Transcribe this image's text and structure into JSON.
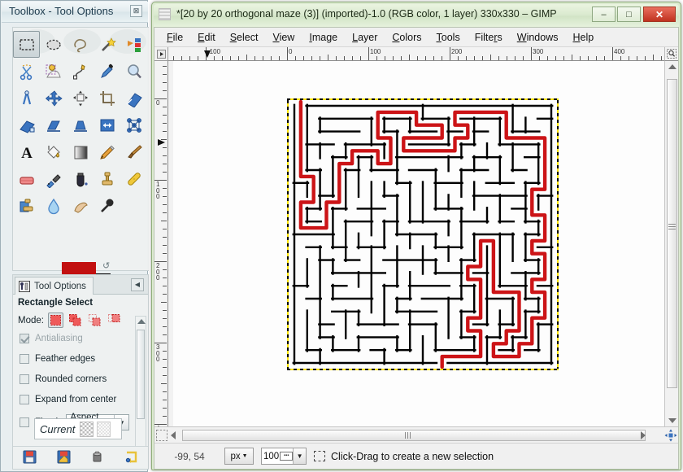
{
  "toolbox": {
    "title": "Toolbox - Tool Options",
    "close_label": "⊠",
    "tools": [
      {
        "name": "rectangle-select-tool",
        "icon": "rect-select",
        "active": true
      },
      {
        "name": "ellipse-select-tool",
        "icon": "ellipse-select",
        "active": false
      },
      {
        "name": "free-select-tool",
        "icon": "lasso",
        "active": false
      },
      {
        "name": "fuzzy-select-tool",
        "icon": "magic-wand",
        "active": false
      },
      {
        "name": "select-by-color-tool",
        "icon": "color-select",
        "active": false
      },
      {
        "name": "scissors-select-tool",
        "icon": "scissors",
        "active": false
      },
      {
        "name": "foreground-select-tool",
        "icon": "foreground-select",
        "active": false
      },
      {
        "name": "paths-tool",
        "icon": "path",
        "active": false
      },
      {
        "name": "color-picker-tool",
        "icon": "eyedropper",
        "active": false
      },
      {
        "name": "zoom-tool",
        "icon": "magnifier",
        "active": false
      },
      {
        "name": "measure-tool",
        "icon": "compass",
        "active": false
      },
      {
        "name": "move-tool",
        "icon": "move-arrows",
        "active": false
      },
      {
        "name": "alignment-tool",
        "icon": "align",
        "active": false
      },
      {
        "name": "crop-tool",
        "icon": "crop",
        "active": false
      },
      {
        "name": "rotate-tool",
        "icon": "rotate",
        "active": false
      },
      {
        "name": "scale-tool",
        "icon": "scale",
        "active": false
      },
      {
        "name": "shear-tool",
        "icon": "shear",
        "active": false
      },
      {
        "name": "perspective-tool",
        "icon": "perspective",
        "active": false
      },
      {
        "name": "flip-tool",
        "icon": "flip",
        "active": false
      },
      {
        "name": "cage-transform-tool",
        "icon": "cage",
        "active": false
      },
      {
        "name": "text-tool",
        "icon": "text-A",
        "active": false
      },
      {
        "name": "bucket-fill-tool",
        "icon": "bucket",
        "active": false
      },
      {
        "name": "gradient-tool",
        "icon": "gradient",
        "active": false
      },
      {
        "name": "pencil-tool",
        "icon": "pencil",
        "active": false
      },
      {
        "name": "paintbrush-tool",
        "icon": "paintbrush",
        "active": false
      },
      {
        "name": "eraser-tool",
        "icon": "eraser",
        "active": false
      },
      {
        "name": "airbrush-tool",
        "icon": "airbrush",
        "active": false
      },
      {
        "name": "ink-tool",
        "icon": "ink",
        "active": false
      },
      {
        "name": "clone-tool",
        "icon": "clone-stamp",
        "active": false
      },
      {
        "name": "heal-tool",
        "icon": "heal-bandage",
        "active": false
      },
      {
        "name": "perspective-clone-tool",
        "icon": "perspective-clone",
        "active": false
      },
      {
        "name": "blur-sharpen-tool",
        "icon": "water-drop",
        "active": false
      },
      {
        "name": "smudge-tool",
        "icon": "smudge-finger",
        "active": false
      },
      {
        "name": "dodge-burn-tool",
        "icon": "dodge-burn",
        "active": false
      }
    ],
    "colors": {
      "foreground": "#c21010",
      "background": "#000000",
      "swap_icon": "swap-colors-icon",
      "default_icon": "default-colors-icon"
    }
  },
  "tool_options": {
    "tab_label": "Tool Options",
    "tab_icon": "tool-options-icon",
    "menu_button_icon": "triangle-left-icon",
    "title": "Rectangle Select",
    "mode_label": "Mode:",
    "modes": [
      {
        "name": "replace-mode",
        "selected": true
      },
      {
        "name": "add-mode",
        "selected": false
      },
      {
        "name": "subtract-mode",
        "selected": false
      },
      {
        "name": "intersect-mode",
        "selected": false
      }
    ],
    "checkboxes": [
      {
        "label": "Antialiasing",
        "checked": true,
        "disabled": true
      },
      {
        "label": "Feather edges",
        "checked": false,
        "disabled": false
      },
      {
        "label": "Rounded corners",
        "checked": false,
        "disabled": false
      },
      {
        "label": "Expand from center",
        "checked": false,
        "disabled": false
      }
    ],
    "fixed": {
      "label": "Fixed:",
      "checked": false,
      "value": "Aspect ratio",
      "arrow": "▼"
    },
    "current_label": "Current",
    "footer_buttons": [
      {
        "name": "save-options-button",
        "icon": "save-icon"
      },
      {
        "name": "restore-options-button",
        "icon": "restore-icon"
      },
      {
        "name": "delete-options-button",
        "icon": "trash-icon"
      },
      {
        "name": "reset-options-button",
        "icon": "reset-icon"
      }
    ]
  },
  "gimp": {
    "title": "*[20 by 20 orthogonal maze (3)] (imported)-1.0 (RGB color, 1 layer) 330x330 – GIMP",
    "window_buttons": {
      "minimize": "–",
      "maximize": "□",
      "close": "✕"
    },
    "menu": [
      {
        "label": "File",
        "mnemonic": "F"
      },
      {
        "label": "Edit",
        "mnemonic": "E"
      },
      {
        "label": "Select",
        "mnemonic": "S"
      },
      {
        "label": "View",
        "mnemonic": "V"
      },
      {
        "label": "Image",
        "mnemonic": "I"
      },
      {
        "label": "Layer",
        "mnemonic": "L"
      },
      {
        "label": "Colors",
        "mnemonic": "C"
      },
      {
        "label": "Tools",
        "mnemonic": "T"
      },
      {
        "label": "Filters",
        "mnemonic": "r"
      },
      {
        "label": "Windows",
        "mnemonic": "W"
      },
      {
        "label": "Help",
        "mnemonic": "H"
      }
    ],
    "rulers": {
      "horizontal_labels": [
        "-100",
        "0",
        "100",
        "200",
        "300",
        "400"
      ],
      "vertical_labels": [
        "0",
        "100",
        "200",
        "300"
      ],
      "unit": "px"
    },
    "statusbar": {
      "position": "-99, 54",
      "unit": "px",
      "unit_arrow": "▼",
      "zoom": "100",
      "zoom_arrow": "▼",
      "selection_icon": "rect-select-icon",
      "message": "Click-Drag to create a new selection"
    },
    "canvas": {
      "image_name": "20 by 20 orthogonal maze (3)",
      "image_size": "330x330",
      "selection_border": "marching-ants",
      "wall_color": "#000000",
      "path_color": "#cc1417",
      "background_color": "#ffffff"
    },
    "scrollbars": {
      "left_arrow": "◀",
      "right_arrow": "▶",
      "up_arrow": "▲",
      "down_arrow": "▼",
      "quick_mask_icon": "quick-mask-icon",
      "navigation_icon": "navigation-icon",
      "zoom_image_icon": "zoom-image-icon"
    }
  }
}
